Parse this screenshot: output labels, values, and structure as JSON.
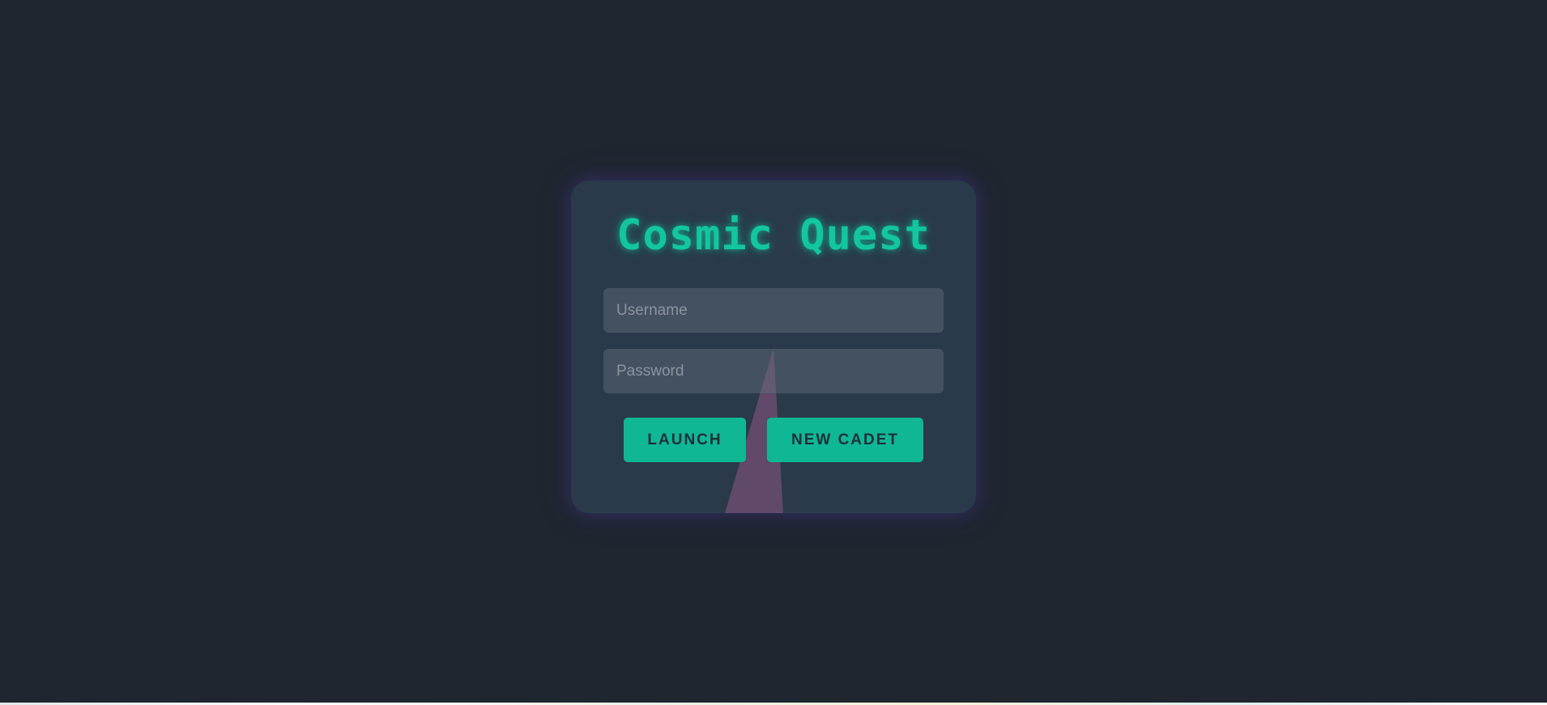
{
  "app": {
    "title": "Cosmic Quest"
  },
  "login": {
    "username_placeholder": "Username",
    "password_placeholder": "Password",
    "launch_label": "LAUNCH",
    "new_cadet_label": "NEW CADET"
  },
  "colors": {
    "background": "#20262f",
    "card": "#2a3a4a",
    "accent": "#12c69f",
    "button": "#0fb795",
    "beam": "#6a4c6e"
  }
}
